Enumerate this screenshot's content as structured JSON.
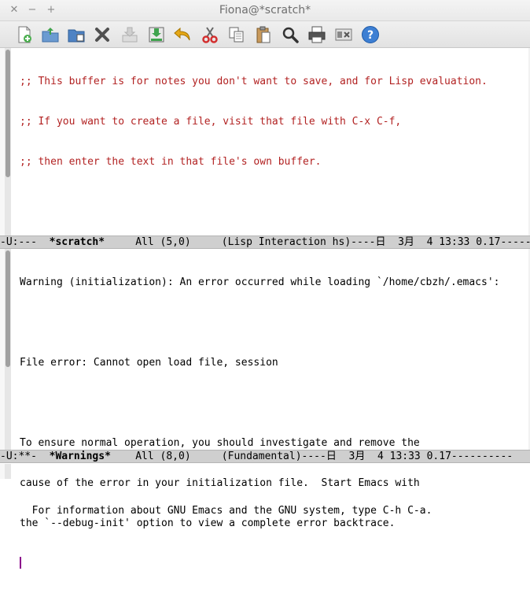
{
  "window": {
    "title": "Fiona@*scratch*",
    "controls": {
      "close": "✕",
      "minimize": "−",
      "maximize": "+"
    }
  },
  "toolbar": {
    "buttons": [
      {
        "name": "new-file",
        "icon": "new-file-icon"
      },
      {
        "name": "open-file",
        "icon": "open-file-icon"
      },
      {
        "name": "open-directory",
        "icon": "open-directory-icon"
      },
      {
        "name": "close-buffer",
        "icon": "close-icon"
      },
      {
        "name": "save",
        "icon": "save-icon"
      },
      {
        "name": "save-as",
        "icon": "save-as-icon"
      },
      {
        "name": "undo",
        "icon": "undo-icon"
      },
      {
        "name": "cut",
        "icon": "cut-icon"
      },
      {
        "name": "copy",
        "icon": "copy-icon"
      },
      {
        "name": "paste",
        "icon": "paste-icon"
      },
      {
        "name": "search",
        "icon": "search-icon"
      },
      {
        "name": "print",
        "icon": "print-icon"
      },
      {
        "name": "preferences",
        "icon": "preferences-icon"
      },
      {
        "name": "help",
        "icon": "help-icon"
      }
    ]
  },
  "scratch": {
    "lines": [
      ";; This buffer is for notes you don't want to save, and for Lisp evaluation.",
      ";; If you want to create a file, visit that file with C-x C-f,",
      ";; then enter the text in that file's own buffer."
    ],
    "modeline": {
      "prefix": "-U:---  ",
      "buffer": "*scratch*",
      "rest": "     All (5,0)     (Lisp Interaction hs)----日  3月  4 13:33 0.17------"
    }
  },
  "warnings": {
    "lines": [
      "Warning (initialization): An error occurred while loading `/home/cbzh/.emacs':",
      "",
      "File error: Cannot open load file, session",
      "",
      "To ensure normal operation, you should investigate and remove the",
      "cause of the error in your initialization file.  Start Emacs with",
      "the `--debug-init' option to view a complete error backtrace."
    ],
    "modeline": {
      "prefix": "-U:**-  ",
      "buffer": "*Warnings*",
      "rest": "    All (8,0)     (Fundamental)----日  3月  4 13:33 0.17----------"
    }
  },
  "minibuffer": {
    "text": "For information about GNU Emacs and the GNU system, type C-h C-a."
  },
  "colors": {
    "comment": "#b22222",
    "cursor": "#8b008b",
    "modeline_bg": "#cfcfcf"
  }
}
